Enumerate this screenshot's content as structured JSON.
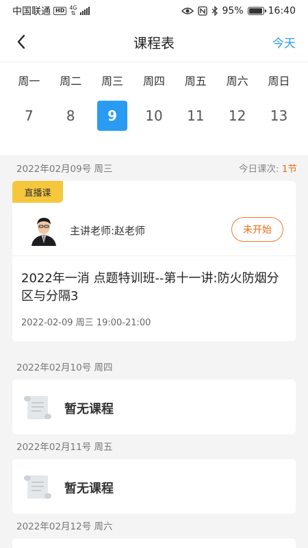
{
  "status_bar": {
    "carrier": "中国联通",
    "hd": "HD",
    "network": "4G",
    "battery": "95%",
    "battery_level": 0.95,
    "time": "16:40"
  },
  "nav": {
    "title": "课程表",
    "today": "今天"
  },
  "week": {
    "days": [
      "周一",
      "周二",
      "周三",
      "周四",
      "周五",
      "周六",
      "周日"
    ],
    "dates": [
      "7",
      "8",
      "9",
      "10",
      "11",
      "12",
      "13"
    ],
    "selected_index": 2
  },
  "sections": [
    {
      "date": "2022年02月09号 周三",
      "count_label": "今日课次:",
      "count_value": "1节",
      "course": {
        "tag": "直播课",
        "teacher": "主讲老师:赵老师",
        "status": "未开始",
        "title": "2022年一消 点题特训班--第十一讲:防火防烟分区与分隔3",
        "time": "2022-02-09 周三 19:00-21:00"
      }
    },
    {
      "date": "2022年02月10号 周四",
      "empty": "暂无课程"
    },
    {
      "date": "2022年02月11号 周五",
      "empty": "暂无课程"
    },
    {
      "date": "2022年02月12号 周六"
    }
  ],
  "colors": {
    "accent": "#2a9bf3",
    "orange": "#ee6b13",
    "live_tag": "#f5c73c"
  }
}
